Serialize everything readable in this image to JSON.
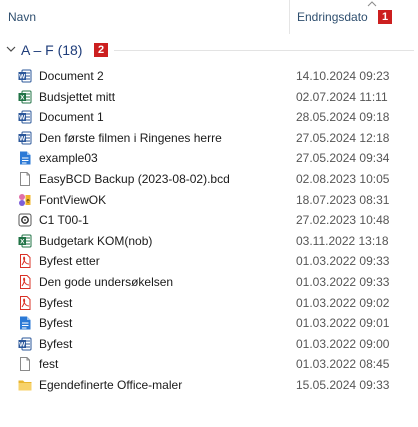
{
  "header": {
    "name_label": "Navn",
    "date_label": "Endringsdato",
    "badge_1": "1"
  },
  "group": {
    "label": "A – F (18)",
    "badge_2": "2"
  },
  "colors": {
    "word": "#2b579a",
    "excel": "#217346",
    "pdf": "#d93025",
    "folder": "#f2c744",
    "badge": "#cc1f1f",
    "group_text": "#1f3d7a"
  },
  "files": [
    {
      "name": "Document 2",
      "date": "14.10.2024 09:23",
      "icon": "word-icon"
    },
    {
      "name": "Budsjettet mitt",
      "date": "02.07.2024 11:11",
      "icon": "excel-icon"
    },
    {
      "name": "Document 1",
      "date": "28.05.2024 09:18",
      "icon": "word-icon"
    },
    {
      "name": "Den første filmen i Ringenes herre",
      "date": "27.05.2024 12:18",
      "icon": "word-icon"
    },
    {
      "name": "example03",
      "date": "27.05.2024 09:34",
      "icon": "document-icon"
    },
    {
      "name": "EasyBCD Backup (2023-08-02).bcd",
      "date": "02.08.2023 10:05",
      "icon": "blank-file-icon"
    },
    {
      "name": "FontViewOK",
      "date": "18.07.2023 08:31",
      "icon": "app-icon"
    },
    {
      "name": "C1 T00-1",
      "date": "27.02.2023 10:48",
      "icon": "disc-icon"
    },
    {
      "name": "Budgetark KOM(nob)",
      "date": "03.11.2022 13:18",
      "icon": "excel-icon"
    },
    {
      "name": "Byfest etter",
      "date": "01.03.2022 09:33",
      "icon": "pdf-icon"
    },
    {
      "name": "Den gode undersøkelsen",
      "date": "01.03.2022 09:33",
      "icon": "pdf-icon"
    },
    {
      "name": "Byfest",
      "date": "01.03.2022 09:02",
      "icon": "pdf-icon"
    },
    {
      "name": "Byfest",
      "date": "01.03.2022 09:01",
      "icon": "document-icon"
    },
    {
      "name": "Byfest",
      "date": "01.03.2022 09:00",
      "icon": "word-icon"
    },
    {
      "name": "fest",
      "date": "01.03.2022 08:45",
      "icon": "blank-file-icon"
    },
    {
      "name": "Egendefinerte Office-maler",
      "date": "15.05.2024 09:33",
      "icon": "folder-icon"
    }
  ]
}
